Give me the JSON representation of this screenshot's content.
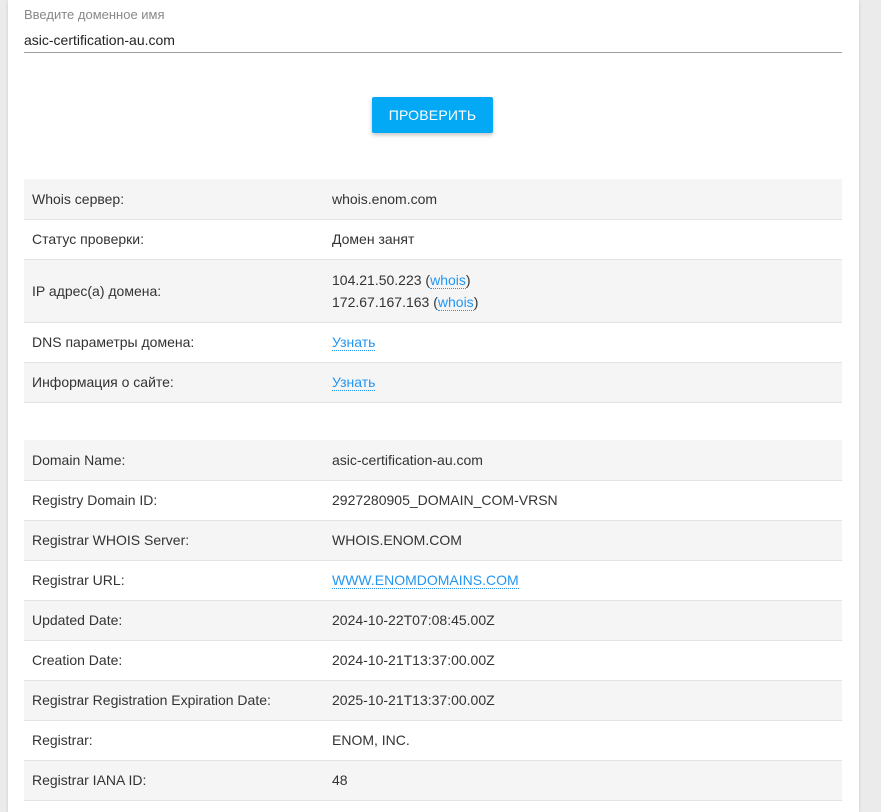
{
  "search": {
    "label": "Введите доменное имя",
    "value": "asic-certification-au.com",
    "button": "ПРОВЕРИТЬ"
  },
  "check_table": {
    "whois_server": {
      "label": "Whois сервер:",
      "value": "whois.enom.com"
    },
    "status": {
      "label": "Статус проверки:",
      "value": "Домен занят"
    },
    "ip": {
      "label": "IP адрес(а) домена:",
      "items": [
        {
          "address": "104.21.50.223",
          "link": "whois"
        },
        {
          "address": "172.67.167.163",
          "link": "whois"
        }
      ]
    },
    "dns": {
      "label": "DNS параметры домена:",
      "link": "Узнать"
    },
    "site_info": {
      "label": "Информация о сайте:",
      "link": "Узнать"
    }
  },
  "whois_table": [
    {
      "label": "Domain Name:",
      "value": "asic-certification-au.com"
    },
    {
      "label": "Registry Domain ID:",
      "value": "2927280905_DOMAIN_COM-VRSN"
    },
    {
      "label": "Registrar WHOIS Server:",
      "value": "WHOIS.ENOM.COM"
    },
    {
      "label": "Registrar URL:",
      "value": "WWW.ENOMDOMAINS.COM",
      "is_link": true
    },
    {
      "label": "Updated Date:",
      "value": "2024-10-22T07:08:45.00Z"
    },
    {
      "label": "Creation Date:",
      "value": "2024-10-21T13:37:00.00Z"
    },
    {
      "label": "Registrar Registration Expiration Date:",
      "value": "2025-10-21T13:37:00.00Z"
    },
    {
      "label": "Registrar:",
      "value": "ENOM, INC."
    },
    {
      "label": "Registrar IANA ID:",
      "value": "48"
    }
  ],
  "colors": {
    "accent": "#03a9f4",
    "link": "#2196f3",
    "stripe": "#f5f5f5"
  }
}
